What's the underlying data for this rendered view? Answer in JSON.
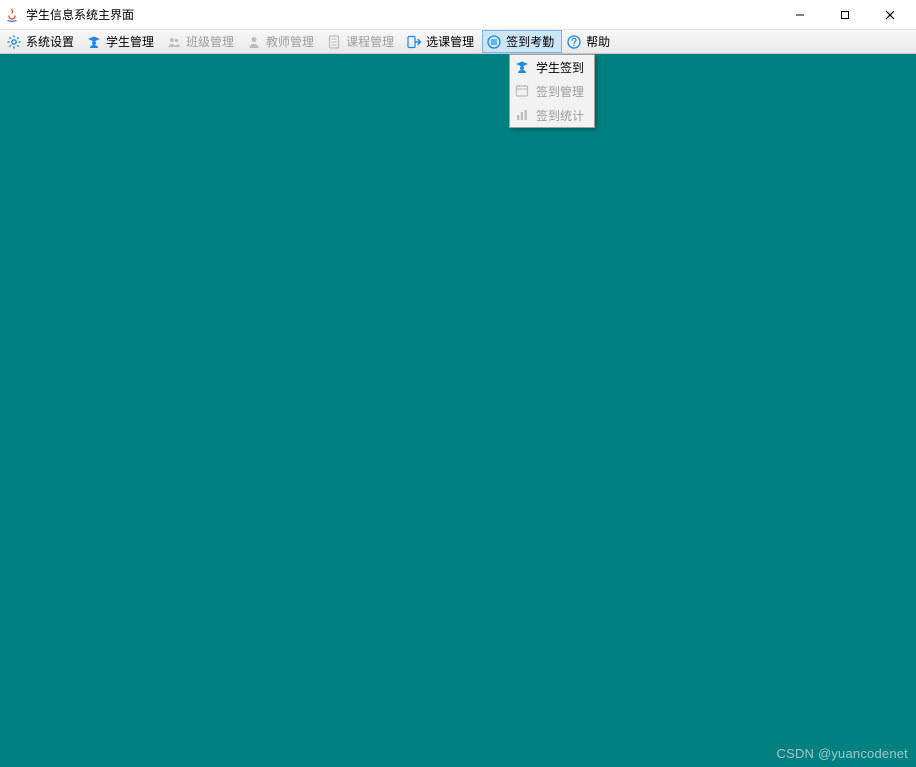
{
  "window": {
    "title": "学生信息系统主界面"
  },
  "menu": {
    "system_settings": "系统设置",
    "student_mgmt": "学生管理",
    "class_mgmt": "班级管理",
    "teacher_mgmt": "教师管理",
    "course_mgmt": "课程管理",
    "course_select_mgmt": "选课管理",
    "attendance": "签到考勤",
    "help": "帮助"
  },
  "dropdown": {
    "student_signin": "学生签到",
    "signin_mgmt": "签到管理",
    "signin_stats": "签到统计"
  },
  "watermark": "CSDN @yuancodenet",
  "colors": {
    "content_bg": "#008080",
    "accent_blue": "#1e88e5",
    "disabled": "#9d9d9d"
  }
}
